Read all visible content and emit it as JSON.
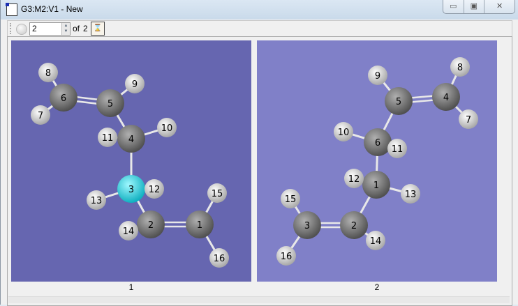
{
  "window": {
    "title": "G3:M2:V1 - New",
    "minimize": "▭",
    "maximize": "▣",
    "close": "✕"
  },
  "toolbar": {
    "current": "2",
    "of_label": "of",
    "total": "2"
  },
  "colors": {
    "panel1": "#6666b0",
    "panel2": "#8080c8",
    "carbon": "#707070",
    "hydrogen": "#e0e0e0",
    "nitrogen": "#20d8e0"
  },
  "molecules": [
    {
      "caption": "1",
      "atoms": [
        {
          "label": "1",
          "element": "C"
        },
        {
          "label": "2",
          "element": "C"
        },
        {
          "label": "3",
          "element": "N"
        },
        {
          "label": "4",
          "element": "C"
        },
        {
          "label": "5",
          "element": "C"
        },
        {
          "label": "6",
          "element": "C"
        },
        {
          "label": "7",
          "element": "H"
        },
        {
          "label": "8",
          "element": "H"
        },
        {
          "label": "9",
          "element": "H"
        },
        {
          "label": "10",
          "element": "H"
        },
        {
          "label": "11",
          "element": "H"
        },
        {
          "label": "12",
          "element": "H"
        },
        {
          "label": "13",
          "element": "H"
        },
        {
          "label": "14",
          "element": "H"
        },
        {
          "label": "15",
          "element": "H"
        },
        {
          "label": "16",
          "element": "H"
        }
      ]
    },
    {
      "caption": "2",
      "atoms": [
        {
          "label": "1",
          "element": "C"
        },
        {
          "label": "2",
          "element": "C"
        },
        {
          "label": "3",
          "element": "C"
        },
        {
          "label": "4",
          "element": "C"
        },
        {
          "label": "5",
          "element": "C"
        },
        {
          "label": "6",
          "element": "C"
        },
        {
          "label": "7",
          "element": "H"
        },
        {
          "label": "8",
          "element": "H"
        },
        {
          "label": "9",
          "element": "H"
        },
        {
          "label": "10",
          "element": "H"
        },
        {
          "label": "11",
          "element": "H"
        },
        {
          "label": "12",
          "element": "H"
        },
        {
          "label": "13",
          "element": "H"
        },
        {
          "label": "14",
          "element": "H"
        },
        {
          "label": "15",
          "element": "H"
        },
        {
          "label": "16",
          "element": "H"
        }
      ]
    }
  ]
}
